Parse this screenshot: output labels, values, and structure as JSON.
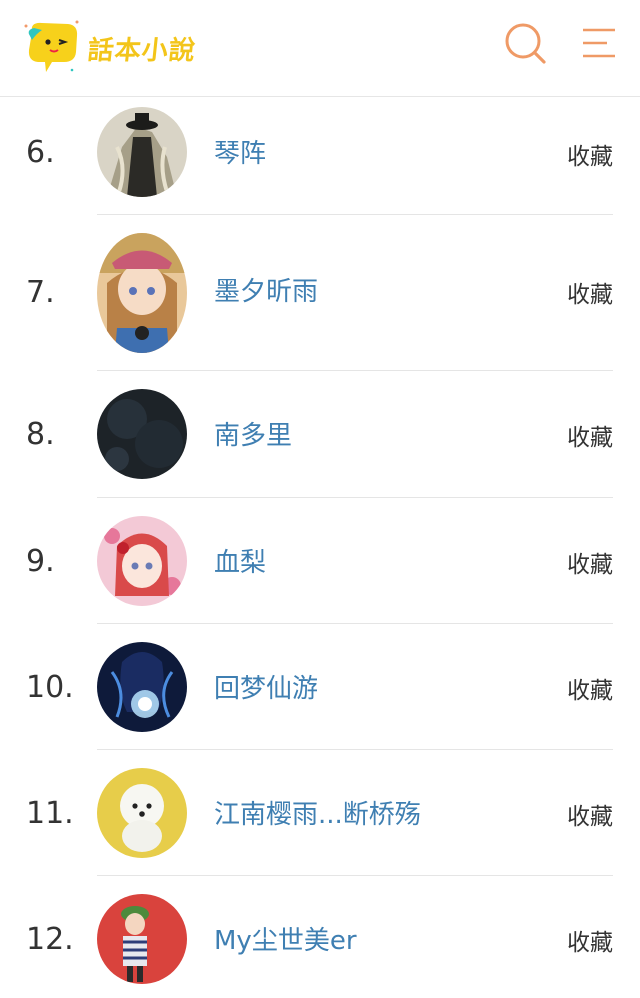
{
  "header": {
    "logo_text": "話本小說",
    "search_icon": "search-icon",
    "menu_icon": "menu-icon",
    "accent_color": "#ef9a66",
    "logo_color": "#f3c51a"
  },
  "authors": [
    {
      "rank": "6.",
      "name": "琴阵",
      "action": "收藏",
      "avatar": "dark-cloaked-figure"
    },
    {
      "rank": "7.",
      "name": "墨夕昕雨",
      "action": "收藏",
      "avatar": "anime-girl-with-hat"
    },
    {
      "rank": "8.",
      "name": "南多里",
      "action": "收藏",
      "avatar": "dark-texture"
    },
    {
      "rank": "9.",
      "name": "血梨",
      "action": "收藏",
      "avatar": "anime-girl-red-hair"
    },
    {
      "rank": "10.",
      "name": "回梦仙游",
      "action": "收藏",
      "avatar": "blue-glowing-figure"
    },
    {
      "rank": "11.",
      "name": "江南樱雨...断桥殇",
      "action": "收藏",
      "avatar": "white-fluffy-dog"
    },
    {
      "rank": "12.",
      "name": "My尘世美er",
      "action": "收藏",
      "avatar": "cartoon-boy-green-hat"
    }
  ],
  "colors": {
    "name_link": "#3f7fb2",
    "rank_text": "#333333",
    "divider": "#e5e5e5"
  }
}
